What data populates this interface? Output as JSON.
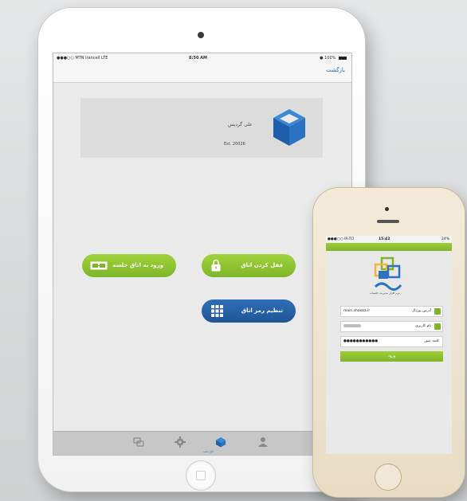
{
  "ipad": {
    "status": {
      "carrier": "●●●○○ MTN Irancell  LTE",
      "time": "8:50 AM",
      "battery": "● 100%"
    },
    "nav": {
      "back": "بازگشت"
    },
    "card": {
      "name": "علی گردیس",
      "established": "Est. 20026"
    },
    "buttons": {
      "enter_room": "ورود به اتاق جلسه",
      "lock_room": "قفل کردن اتاق",
      "set_password": "تنظیم رمز اتاق"
    },
    "tabbar": {
      "active_label": "اتاق جلسه"
    }
  },
  "iphone": {
    "status": {
      "carrier": "●●●○○ IR-TCI",
      "time": "15:42",
      "battery": "24%"
    },
    "logo_subtitle": "نرم افزار مدیریت جلسات",
    "form": {
      "portal_value": "main.shooka.ir",
      "portal_label": "آدرس پورتال",
      "username_label": "نام کاربری",
      "password_value": "●●●●●●●●●●●",
      "password_label": "کلمه عبور",
      "login": "ورود"
    }
  },
  "colors": {
    "green": "#8dc53a",
    "blue": "#2463aa",
    "link": "#2b6cc4"
  }
}
